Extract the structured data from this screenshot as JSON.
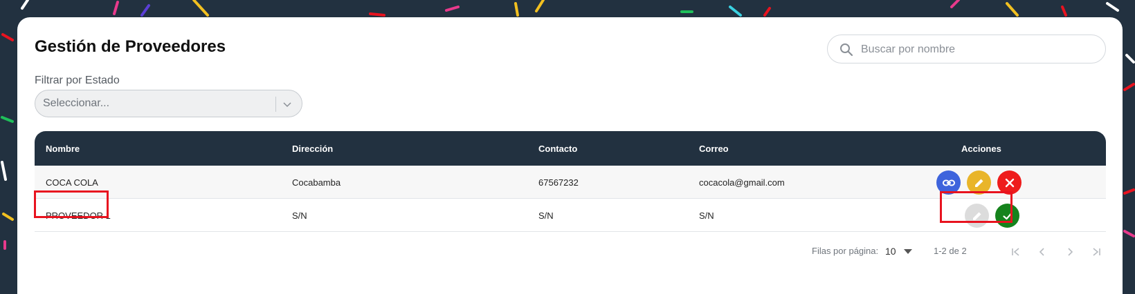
{
  "page": {
    "title": "Gestión de Proveedores"
  },
  "search": {
    "placeholder": "Buscar por nombre",
    "value": ""
  },
  "filter": {
    "label": "Filtrar por Estado",
    "placeholder": "Seleccionar..."
  },
  "table": {
    "headers": [
      "Nombre",
      "Dirección",
      "Contacto",
      "Correo",
      "Acciones"
    ],
    "rows": [
      {
        "nombre": "COCA COLA",
        "direccion": "Cocabamba",
        "contacto": "67567232",
        "correo": "cocacola@gmail.com",
        "actions": [
          "link-icon",
          "edit-icon",
          "close-icon"
        ]
      },
      {
        "nombre": "PROVEEDOR 1",
        "direccion": "S/N",
        "contacto": "S/N",
        "correo": "S/N",
        "actions": [
          "edit-icon",
          "check-icon"
        ]
      }
    ]
  },
  "pagination": {
    "rows_per_page_label": "Filas por página:",
    "rows_per_page_value": "10",
    "range": "1-2 de 2"
  },
  "colors": {
    "background": "#223140",
    "header": "#223140",
    "link_button": "#3e64dc",
    "edit_button": "#e9b52a",
    "delete_button": "#ee1c1c",
    "disabled_button": "#dcdcdc",
    "activate_button": "#15831c",
    "highlight": "#e8131f"
  }
}
